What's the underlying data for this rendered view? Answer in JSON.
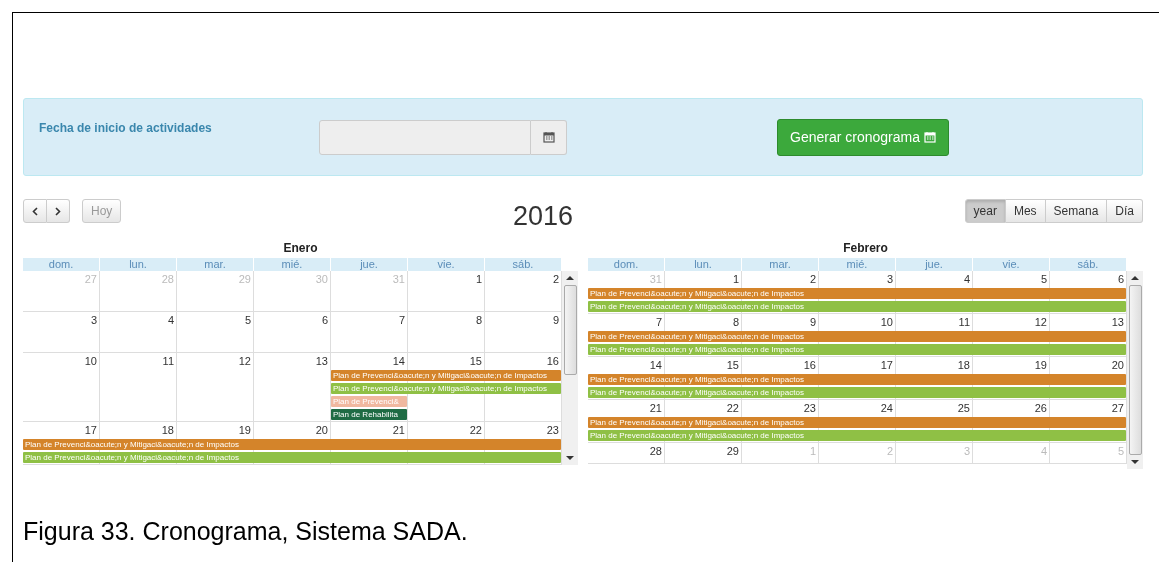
{
  "form": {
    "label": "Fecha de inicio de actividades",
    "generate_button": {
      "label": "Generar cronograma"
    }
  },
  "toolbar": {
    "today_button": {
      "label": "Hoy",
      "disabled": true
    },
    "title": "2016",
    "views": [
      {
        "label": "year",
        "selected": true
      },
      {
        "label": "Mes",
        "selected": false
      },
      {
        "label": "Semana",
        "selected": false
      },
      {
        "label": "Día",
        "selected": false
      }
    ]
  },
  "months": [
    {
      "title": "Enero",
      "weekdays": [
        "dom.",
        "lun.",
        "mar.",
        "mié.",
        "jue.",
        "vie.",
        "sáb."
      ],
      "weeks": [
        {
          "days": [
            {
              "label": "27",
              "muted": true
            },
            {
              "label": "28",
              "muted": true
            },
            {
              "label": "29",
              "muted": true
            },
            {
              "label": "30",
              "muted": true
            },
            {
              "label": "31",
              "muted": true
            },
            {
              "label": "1",
              "muted": false
            },
            {
              "label": "2",
              "muted": false
            }
          ]
        },
        {
          "days": [
            {
              "label": "3",
              "muted": false
            },
            {
              "label": "4",
              "muted": false
            },
            {
              "label": "5",
              "muted": false
            },
            {
              "label": "6",
              "muted": false
            },
            {
              "label": "7",
              "muted": false
            },
            {
              "label": "8",
              "muted": false
            },
            {
              "label": "9",
              "muted": false
            }
          ]
        },
        {
          "days": [
            {
              "label": "10",
              "muted": false
            },
            {
              "label": "11",
              "muted": false
            },
            {
              "label": "12",
              "muted": false
            },
            {
              "label": "13",
              "muted": false
            },
            {
              "label": "14",
              "muted": false,
              "events": [
                {
                  "text": "Plan de Prevenci&oacute;n y Mitigaci&oacute;n de Impactos",
                  "color": "#d4842a",
                  "kind": "to-week-end"
                },
                {
                  "text": "Plan de Prevenci&oacute;n y Mitigaci&oacute;n de Impactos",
                  "color": "#8fc045",
                  "kind": "to-week-end"
                },
                {
                  "text": "Plan de Prevenci&",
                  "color": "#f0b8a0",
                  "kind": "one-day"
                },
                {
                  "text": "Plan de Rehabilita",
                  "color": "#1f6b44",
                  "kind": "one-day"
                }
              ]
            },
            {
              "label": "15",
              "muted": false
            },
            {
              "label": "16",
              "muted": false
            }
          ]
        },
        {
          "days": [
            {
              "label": "17",
              "muted": false,
              "events": [
                {
                  "text": "Plan de Prevenci&oacute;n y Mitigaci&oacute;n de Impactos",
                  "color": "#d4842a",
                  "kind": "to-week-end"
                },
                {
                  "text": "Plan de Prevenci&oacute;n y Mitigaci&oacute;n de Impactos",
                  "color": "#8fc045",
                  "kind": "to-week-end"
                }
              ]
            },
            {
              "label": "18",
              "muted": false
            },
            {
              "label": "19",
              "muted": false
            },
            {
              "label": "20",
              "muted": false
            },
            {
              "label": "21",
              "muted": false
            },
            {
              "label": "22",
              "muted": false
            },
            {
              "label": "23",
              "muted": false
            }
          ]
        }
      ]
    },
    {
      "title": "Febrero",
      "weekdays": [
        "dom.",
        "lun.",
        "mar.",
        "mié.",
        "jue.",
        "vie.",
        "sáb."
      ],
      "weeks": [
        {
          "days": [
            {
              "label": "31",
              "muted": true,
              "events": [
                {
                  "text": "Plan de Prevenci&oacute;n y Mitigaci&oacute;n de Impactos",
                  "color": "#d4842a",
                  "kind": "to-week-end"
                },
                {
                  "text": "Plan de Prevenci&oacute;n y Mitigaci&oacute;n de Impactos",
                  "color": "#8fc045",
                  "kind": "to-week-end"
                }
              ]
            },
            {
              "label": "1",
              "muted": false
            },
            {
              "label": "2",
              "muted": false
            },
            {
              "label": "3",
              "muted": false
            },
            {
              "label": "4",
              "muted": false
            },
            {
              "label": "5",
              "muted": false
            },
            {
              "label": "6",
              "muted": false
            }
          ]
        },
        {
          "days": [
            {
              "label": "7",
              "muted": false,
              "events": [
                {
                  "text": "Plan de Prevenci&oacute;n y Mitigaci&oacute;n de Impactos",
                  "color": "#d4842a",
                  "kind": "to-week-end"
                },
                {
                  "text": "Plan de Prevenci&oacute;n y Mitigaci&oacute;n de Impactos",
                  "color": "#8fc045",
                  "kind": "to-week-end"
                }
              ]
            },
            {
              "label": "8",
              "muted": false
            },
            {
              "label": "9",
              "muted": false
            },
            {
              "label": "10",
              "muted": false
            },
            {
              "label": "11",
              "muted": false
            },
            {
              "label": "12",
              "muted": false
            },
            {
              "label": "13",
              "muted": false
            }
          ]
        },
        {
          "days": [
            {
              "label": "14",
              "muted": false,
              "events": [
                {
                  "text": "Plan de Prevenci&oacute;n y Mitigaci&oacute;n de Impactos",
                  "color": "#d4842a",
                  "kind": "to-week-end"
                },
                {
                  "text": "Plan de Prevenci&oacute;n y Mitigaci&oacute;n de Impactos",
                  "color": "#8fc045",
                  "kind": "to-week-end"
                }
              ]
            },
            {
              "label": "15",
              "muted": false
            },
            {
              "label": "16",
              "muted": false
            },
            {
              "label": "17",
              "muted": false
            },
            {
              "label": "18",
              "muted": false
            },
            {
              "label": "19",
              "muted": false
            },
            {
              "label": "20",
              "muted": false
            }
          ]
        },
        {
          "days": [
            {
              "label": "21",
              "muted": false,
              "events": [
                {
                  "text": "Plan de Prevenci&oacute;n y Mitigaci&oacute;n de Impactos",
                  "color": "#d4842a",
                  "kind": "to-week-end"
                },
                {
                  "text": "Plan de Prevenci&oacute;n y Mitigaci&oacute;n de Impactos",
                  "color": "#8fc045",
                  "kind": "to-week-end"
                }
              ]
            },
            {
              "label": "22",
              "muted": false
            },
            {
              "label": "23",
              "muted": false
            },
            {
              "label": "24",
              "muted": false
            },
            {
              "label": "25",
              "muted": false
            },
            {
              "label": "26",
              "muted": false
            },
            {
              "label": "27",
              "muted": false
            }
          ]
        },
        {
          "days": [
            {
              "label": "28",
              "muted": false
            },
            {
              "label": "29",
              "muted": false
            },
            {
              "label": "1",
              "muted": true
            },
            {
              "label": "2",
              "muted": true
            },
            {
              "label": "3",
              "muted": true
            },
            {
              "label": "4",
              "muted": true
            },
            {
              "label": "5",
              "muted": true
            }
          ]
        }
      ]
    }
  ],
  "caption": "Figura 33. Cronograma, Sistema SADA."
}
